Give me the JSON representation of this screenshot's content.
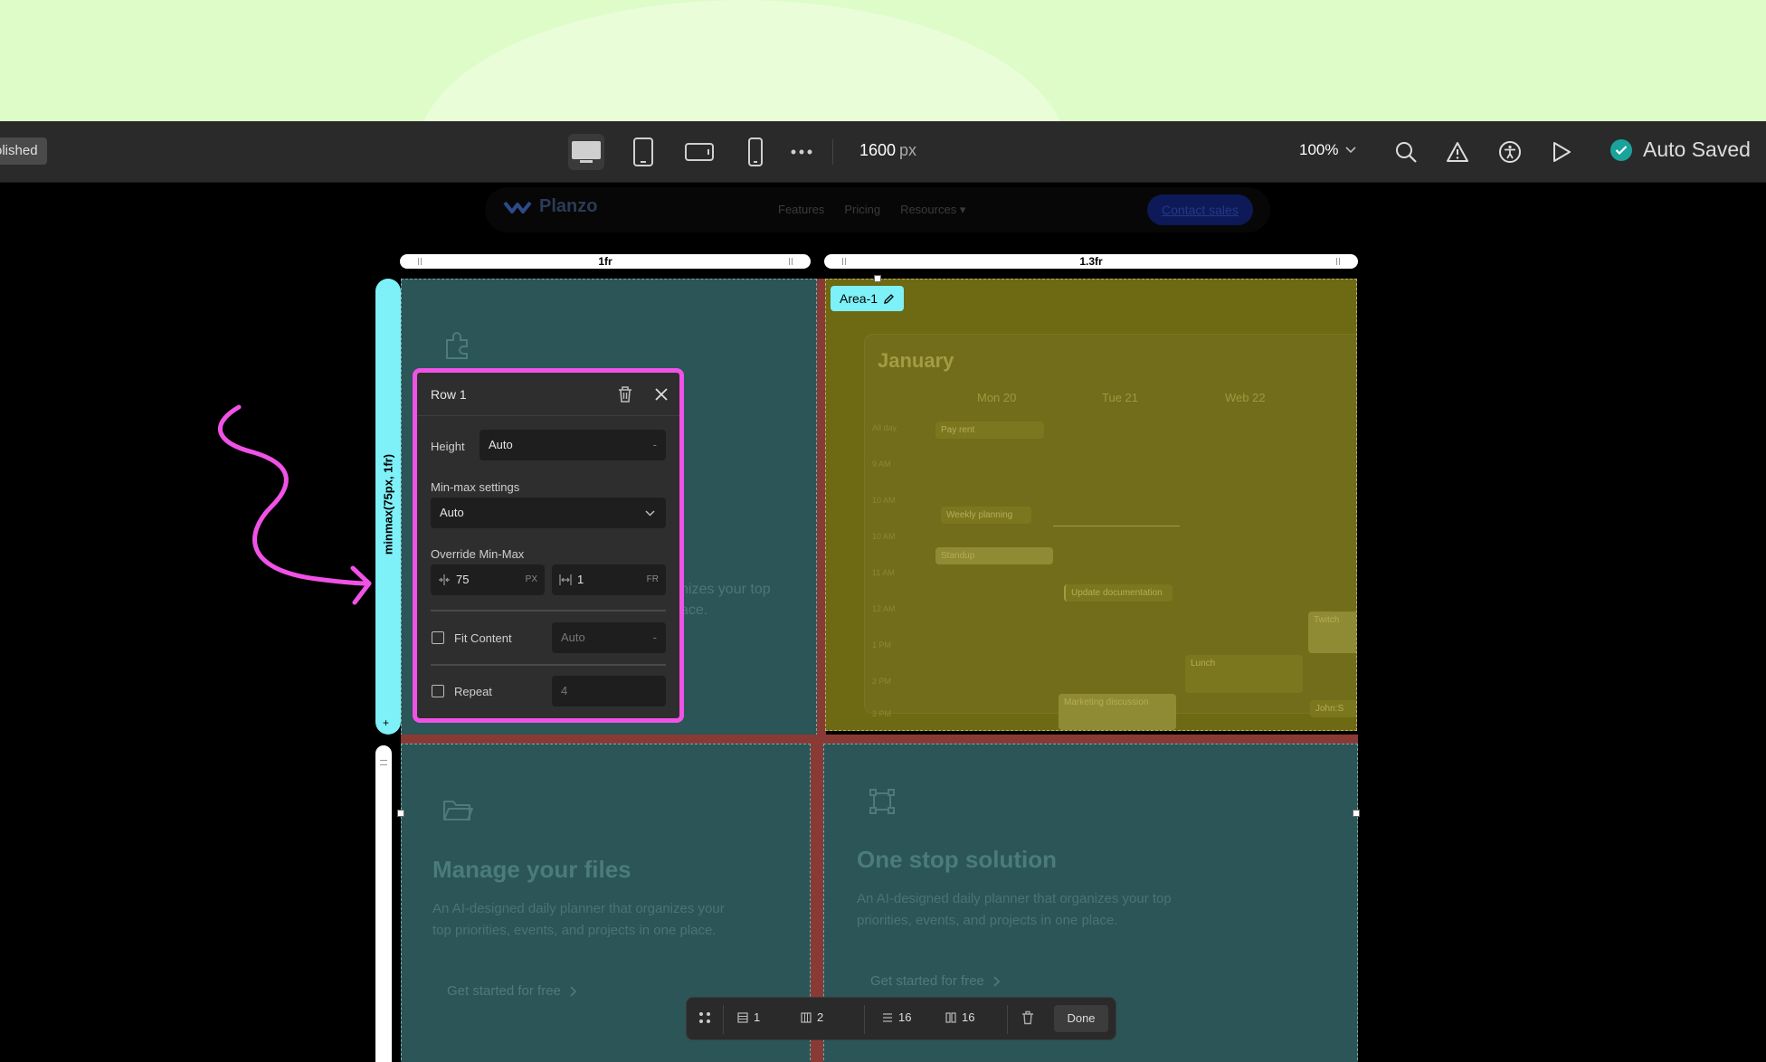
{
  "topbar": {
    "publish_badge": "olished",
    "width_value": "1600",
    "width_unit": "px",
    "zoom": "100%",
    "status": "Auto Saved",
    "devices": [
      "desktop-icon",
      "tablet-icon",
      "tablet-landscape-icon",
      "mobile-icon",
      "more-icon"
    ],
    "tools": [
      "search-icon",
      "warning-icon",
      "accessibility-icon",
      "play-icon"
    ]
  },
  "site_nav": {
    "logo": "Planzo",
    "links": [
      "Features",
      "Pricing",
      "Resources"
    ],
    "cta": "Contact sales"
  },
  "grid": {
    "columns": [
      "1fr",
      "1.3fr"
    ],
    "row_label": "minmax(75px, 1fr)",
    "area_tag": "Area-1"
  },
  "row_panel": {
    "title": "Row 1",
    "height_label": "Height",
    "height_value": "Auto",
    "dash": "-",
    "minmax_label": "Min-max settings",
    "minmax_value": "Auto",
    "override_label": "Override Min-Max",
    "min_value": "75",
    "min_unit": "PX",
    "max_value": "1",
    "max_unit": "FR",
    "fit_content_label": "Fit Content",
    "fit_content_value": "Auto",
    "repeat_label": "Repeat",
    "repeat_value": "4"
  },
  "calendar": {
    "month": "January",
    "days": [
      "Mon 20",
      "Tue 21",
      "Web 22"
    ],
    "hours": [
      "All day",
      "9 AM",
      "10 AM",
      "10 AM",
      "11 AM",
      "12 AM",
      "1 PM",
      "2 PM",
      "3 PM"
    ],
    "events": [
      "Pay rent",
      "Weekly planning",
      "Standup",
      "Update documentation",
      "Lunch",
      "Marketing discussion",
      "Twitch",
      "John:S"
    ]
  },
  "cells": {
    "top_left_fragment_1": "nizes your top",
    "top_left_fragment_2": "ace.",
    "manage": {
      "title": "Manage your files",
      "desc_1": "An AI-designed daily planner that organizes your",
      "desc_2": "top priorities, events, and projects in one place.",
      "link": "Get started for free"
    },
    "onestop": {
      "title": "One stop solution",
      "desc_1": "An AI-designed daily planner that organizes your top",
      "desc_2": "priorities, events, and projects in one place.",
      "link": "Get started for free"
    }
  },
  "bottom_bar": {
    "rows": "1",
    "cols": "2",
    "row_gap": "16",
    "col_gap": "16",
    "done": "Done"
  },
  "colors": {
    "accent_cyan": "#7ef0f8",
    "highlight_magenta": "#f052e6",
    "saved_check": "#1aa39b"
  }
}
